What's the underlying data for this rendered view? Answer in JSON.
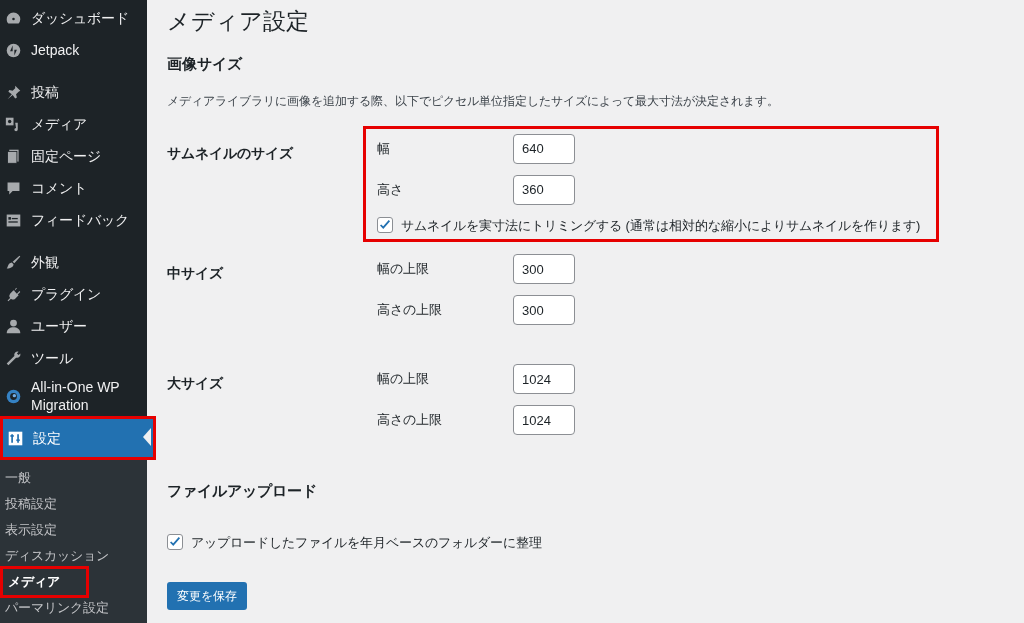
{
  "sidebar": {
    "groups": [
      [
        {
          "label": "ダッシュボード",
          "selected": false,
          "highlighted": false
        },
        {
          "label": "Jetpack",
          "selected": false,
          "highlighted": false
        }
      ],
      [
        {
          "label": "投稿",
          "selected": false,
          "highlighted": false
        },
        {
          "label": "メディア",
          "selected": false,
          "highlighted": false
        },
        {
          "label": "固定ページ",
          "selected": false,
          "highlighted": false
        },
        {
          "label": "コメント",
          "selected": false,
          "highlighted": false
        },
        {
          "label": "フィードバック",
          "selected": false,
          "highlighted": false
        }
      ],
      [
        {
          "label": "外観",
          "selected": false,
          "highlighted": false
        },
        {
          "label": "プラグイン",
          "selected": false,
          "highlighted": false
        },
        {
          "label": "ユーザー",
          "selected": false,
          "highlighted": false
        },
        {
          "label": "ツール",
          "selected": false,
          "highlighted": false
        },
        {
          "label": "All-in-One WP Migration",
          "selected": false,
          "highlighted": false
        },
        {
          "label": "設定",
          "selected": true,
          "highlighted": true,
          "children": [
            {
              "label": "一般",
              "selected": false,
              "highlighted": false
            },
            {
              "label": "投稿設定",
              "selected": false,
              "highlighted": false
            },
            {
              "label": "表示設定",
              "selected": false,
              "highlighted": false
            },
            {
              "label": "ディスカッション",
              "selected": false,
              "highlighted": false
            },
            {
              "label": "メディア",
              "selected": true,
              "highlighted": true
            },
            {
              "label": "パーマリンク設定",
              "selected": false,
              "highlighted": false
            }
          ]
        }
      ]
    ]
  },
  "page_title": "メディア設定",
  "image_sizes": {
    "heading": "画像サイズ",
    "description": "メディアライブラリに画像を追加する際、以下でピクセル単位指定したサイズによって最大寸法が決定されます。",
    "sizes": [
      {
        "label": "サムネイルのサイズ",
        "highlighted": true,
        "fields": [
          {
            "label": "幅",
            "value": "640"
          },
          {
            "label": "高さ",
            "value": "360"
          }
        ],
        "crop_option": {
          "label": "サムネイルを実寸法にトリミングする (通常は相対的な縮小によりサムネイルを作ります)",
          "checked": true
        }
      },
      {
        "label": "中サイズ",
        "highlighted": false,
        "fields": [
          {
            "label": "幅の上限",
            "value": "300"
          },
          {
            "label": "高さの上限",
            "value": "300"
          }
        ]
      },
      {
        "label": "大サイズ",
        "highlighted": false,
        "fields": [
          {
            "label": "幅の上限",
            "value": "1024"
          },
          {
            "label": "高さの上限",
            "value": "1024"
          }
        ]
      }
    ]
  },
  "file_uploads": {
    "heading": "ファイルアップロード",
    "option": {
      "label": "アップロードしたファイルを年月ベースのフォルダーに整理",
      "checked": true
    }
  },
  "save_button": "変更を保存"
}
